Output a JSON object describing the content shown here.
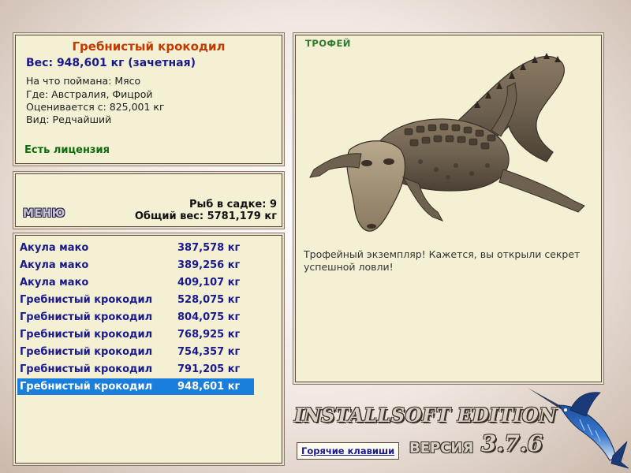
{
  "info": {
    "fish_name": "Гребнистый крокодил",
    "weight": "Вес: 948,601 кг (зачетная)",
    "caught_on": "На что поймана: Мясо",
    "location": "Где: Австралия, Фицрой",
    "valued_from": "Оценивается с: 825,001 кг",
    "rarity": "Вид: Редчайший",
    "license": "Есть лицензия"
  },
  "menu": {
    "menu_label": "МЕНЮ",
    "fish_in_cage": "Рыб в садке: 9",
    "total_weight": "Общий вес: 5781,179 кг"
  },
  "catches": [
    {
      "name": "Акула мако",
      "weight": "387,578 кг"
    },
    {
      "name": "Акула мако",
      "weight": "389,256 кг"
    },
    {
      "name": "Акула мако",
      "weight": "409,107 кг"
    },
    {
      "name": "Гребнистый крокодил",
      "weight": "528,075 кг"
    },
    {
      "name": "Гребнистый крокодил",
      "weight": "804,075 кг"
    },
    {
      "name": "Гребнистый крокодил",
      "weight": "768,925 кг"
    },
    {
      "name": "Гребнистый крокодил",
      "weight": "754,357 кг"
    },
    {
      "name": "Гребнистый крокодил",
      "weight": "791,205 кг"
    },
    {
      "name": "Гребнистый крокодил",
      "weight": "948,601 кг"
    }
  ],
  "selected_index": 8,
  "trophy": {
    "label": "ТРОФЕЙ",
    "text": "Трофейный экземпляр! Кажется, вы открыли секрет успешной ловли!"
  },
  "footer": {
    "brand": "INSTALLSOFT EDITION",
    "version_label": "ВЕРСИЯ",
    "version_number": "3.7.6",
    "hotkeys": "Горячие клавиши"
  },
  "colors": {
    "title_accent": "#c33a00",
    "list_text": "#1a1a8c",
    "selection": "#1a7fdc",
    "panel_bg": "#f3f0d3",
    "license_green": "#0e6b0e"
  },
  "icons": {
    "trophy_image": "crocodile-image",
    "logo": "marlin-icon"
  }
}
